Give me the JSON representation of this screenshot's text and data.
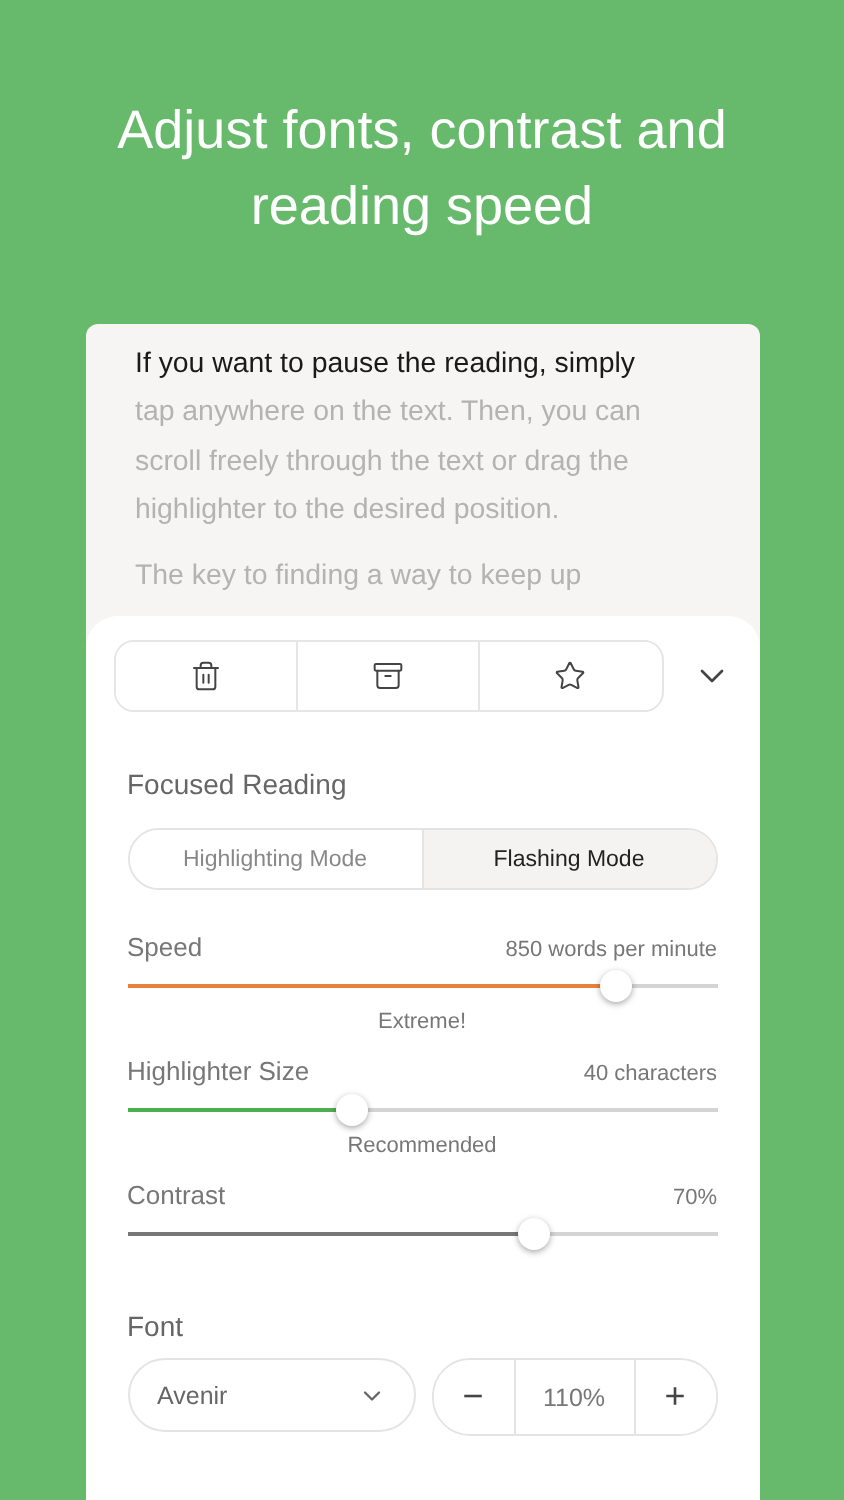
{
  "headline": "Adjust fonts, contrast and reading speed",
  "reader": {
    "paragraphs": [
      {
        "lines": [
          {
            "text": "If you want to pause the reading, simply",
            "highlighted": true
          },
          {
            "text": "tap anywhere on the text. Then, you can",
            "highlighted": false
          },
          {
            "text": "scroll freely through the text or drag the",
            "highlighted": false
          },
          {
            "text": "highlighter to the desired position.",
            "highlighted": false
          }
        ]
      },
      {
        "lines": [
          {
            "text": "The key to finding a way to keep up",
            "highlighted": false
          }
        ]
      }
    ]
  },
  "toolbar": {
    "actions": [
      {
        "kind": "trash"
      },
      {
        "kind": "archive"
      },
      {
        "kind": "star"
      }
    ],
    "collapse": {
      "kind": "chevron"
    }
  },
  "focused_reading": {
    "title": "Focused Reading",
    "modes": [
      {
        "label": "Highlighting Mode",
        "selected": false
      },
      {
        "label": "Flashing Mode",
        "selected": true
      }
    ]
  },
  "sliders": [
    {
      "label": "Speed",
      "reading": "850 words per minute",
      "level": 0.83,
      "color": "#e8803a",
      "note": "Extreme!"
    },
    {
      "label": "Highlighter Size",
      "reading": "40 characters",
      "level": 0.38,
      "color": "#4caf50",
      "note": "Recommended"
    },
    {
      "label": "Contrast",
      "reading": "70%",
      "level": 0.69,
      "color": "#777777"
    }
  ],
  "font": {
    "title": "Font",
    "family": "Avenir",
    "size": "110%",
    "decrease": "−",
    "increase": "+"
  }
}
